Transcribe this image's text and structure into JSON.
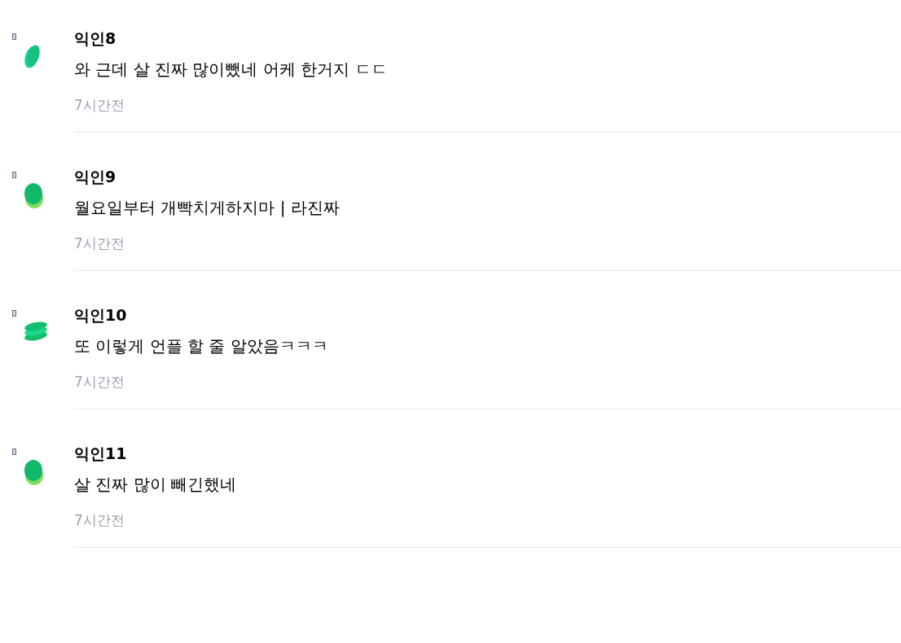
{
  "comments": [
    {
      "author": "익인8",
      "text": "와 근데 살 진짜 많이뺐네 어케 한거지 ㄷㄷ",
      "time": "7시간전",
      "avatar": {
        "kind": "tilted"
      }
    },
    {
      "author": "익인9",
      "text": "월요일부터 개빡치게하지마 | 라진짜",
      "time": "7시간전",
      "avatar": {
        "kind": "layered"
      }
    },
    {
      "author": "익인10",
      "text": "또 이렇게 언플 할 줄 알았음ㅋㅋㅋ",
      "time": "7시간전",
      "avatar": {
        "kind": "stacked"
      }
    },
    {
      "author": "익인11",
      "text": "살 진짜 많이 빼긴했네",
      "time": "7시간전",
      "avatar": {
        "kind": "layered"
      }
    }
  ]
}
